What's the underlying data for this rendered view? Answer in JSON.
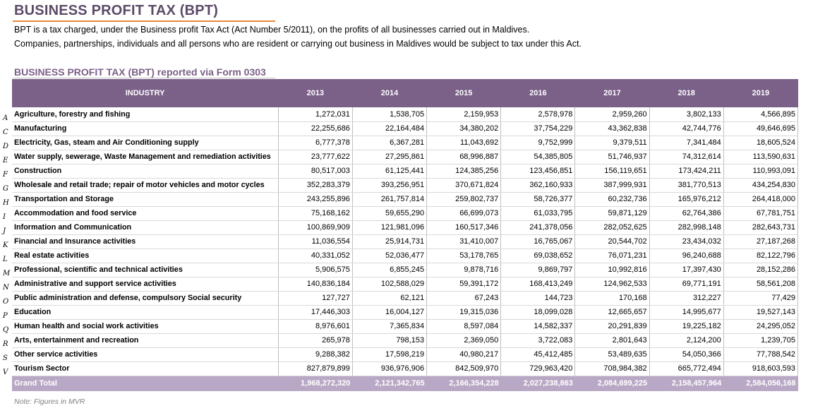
{
  "header": {
    "title": "BUSINESS PROFIT TAX (BPT)",
    "desc_line1": "BPT is a tax charged, under the Business profit Tax Act (Act Number 5/2011), on the profits of all businesses carried out in Maldives.",
    "desc_line2": "Companies, partnerships, individuals and all persons who are resident or carrying out business in Maldives would be subject to tax under this Act."
  },
  "table_title": "BUSINESS PROFIT TAX (BPT) reported via Form 0303",
  "columns": {
    "industry": "INDUSTRY",
    "years": [
      "2013",
      "2014",
      "2015",
      "2016",
      "2017",
      "2018",
      "2019"
    ]
  },
  "rows": [
    {
      "letter": "A",
      "industry": "Agriculture, forestry and fishing",
      "values": [
        "1,272,031",
        "1,538,705",
        "2,159,953",
        "2,578,978",
        "2,959,260",
        "3,802,133",
        "4,566,895"
      ]
    },
    {
      "letter": "C",
      "industry": "Manufacturing",
      "values": [
        "22,255,686",
        "22,164,484",
        "34,380,202",
        "37,754,229",
        "43,362,838",
        "42,744,776",
        "49,646,695"
      ]
    },
    {
      "letter": "D",
      "industry": "Electricity, Gas, steam and Air Conditioning supply",
      "values": [
        "6,777,378",
        "6,367,281",
        "11,043,692",
        "9,752,999",
        "9,379,511",
        "7,341,484",
        "18,605,524"
      ]
    },
    {
      "letter": "E",
      "industry": "Water supply, sewerage, Waste Management and remediation activities",
      "values": [
        "23,777,622",
        "27,295,861",
        "68,996,887",
        "54,385,805",
        "51,746,937",
        "74,312,614",
        "113,590,631"
      ]
    },
    {
      "letter": "F",
      "industry": "Construction",
      "values": [
        "80,517,003",
        "61,125,441",
        "124,385,256",
        "123,456,851",
        "156,119,651",
        "173,424,211",
        "110,993,091"
      ]
    },
    {
      "letter": "G",
      "industry": "Wholesale and retail trade; repair of motor vehicles and motor cycles",
      "values": [
        "352,283,379",
        "393,256,951",
        "370,671,824",
        "362,160,933",
        "387,999,931",
        "381,770,513",
        "434,254,830"
      ]
    },
    {
      "letter": "H",
      "industry": "Transportation and Storage",
      "values": [
        "243,255,896",
        "261,757,814",
        "259,802,737",
        "58,726,377",
        "60,232,736",
        "165,976,212",
        "264,418,000"
      ]
    },
    {
      "letter": "I",
      "industry": "Accommodation and food service",
      "values": [
        "75,168,162",
        "59,655,290",
        "66,699,073",
        "61,033,795",
        "59,871,129",
        "62,764,386",
        "67,781,751"
      ]
    },
    {
      "letter": "J",
      "industry": "Information and Communication",
      "values": [
        "100,869,909",
        "121,981,096",
        "160,517,346",
        "241,378,056",
        "282,052,625",
        "282,998,148",
        "282,643,731"
      ]
    },
    {
      "letter": "K",
      "industry": "Financial and Insurance activities",
      "values": [
        "11,036,554",
        "25,914,731",
        "31,410,007",
        "16,765,067",
        "20,544,702",
        "23,434,032",
        "27,187,268"
      ]
    },
    {
      "letter": "L",
      "industry": "Real estate activities",
      "values": [
        "40,331,052",
        "52,036,477",
        "53,178,765",
        "69,038,652",
        "76,071,231",
        "96,240,688",
        "82,122,796"
      ]
    },
    {
      "letter": "M",
      "industry": "Professional, scientific and technical activities",
      "values": [
        "5,906,575",
        "6,855,245",
        "9,878,716",
        "9,869,797",
        "10,992,816",
        "17,397,430",
        "28,152,286"
      ]
    },
    {
      "letter": "N",
      "industry": "Administrative and support service activities",
      "values": [
        "140,836,184",
        "102,588,029",
        "59,391,172",
        "168,413,249",
        "124,962,533",
        "69,771,191",
        "58,561,208"
      ]
    },
    {
      "letter": "O",
      "industry": "Public administration and defense, compulsory Social security",
      "values": [
        "127,727",
        "62,121",
        "67,243",
        "144,723",
        "170,168",
        "312,227",
        "77,429"
      ]
    },
    {
      "letter": "P",
      "industry": "Education",
      "values": [
        "17,446,303",
        "16,004,127",
        "19,315,036",
        "18,099,028",
        "12,665,657",
        "14,995,677",
        "19,527,143"
      ]
    },
    {
      "letter": "Q",
      "industry": "Human health and social work activities",
      "values": [
        "8,976,601",
        "7,365,834",
        "8,597,084",
        "14,582,337",
        "20,291,839",
        "19,225,182",
        "24,295,052"
      ]
    },
    {
      "letter": "R",
      "industry": "Arts, entertainment and recreation",
      "values": [
        "265,978",
        "798,153",
        "2,369,050",
        "3,722,083",
        "2,801,643",
        "2,124,200",
        "1,239,705"
      ]
    },
    {
      "letter": "S",
      "industry": "Other service activities",
      "values": [
        "9,288,382",
        "17,598,219",
        "40,980,217",
        "45,412,485",
        "53,489,635",
        "54,050,366",
        "77,788,542"
      ]
    },
    {
      "letter": "V",
      "industry": "Tourism Sector",
      "values": [
        "827,879,899",
        "936,976,906",
        "842,509,970",
        "729,963,420",
        "708,984,382",
        "665,772,494",
        "918,603,593"
      ]
    }
  ],
  "grand_total": {
    "label": "Grand Total",
    "values": [
      "1,968,272,320",
      "2,121,342,765",
      "2,166,354,228",
      "2,027,238,863",
      "2,084,699,225",
      "2,158,457,964",
      "2,584,056,168"
    ]
  },
  "note": "Note: Figures in MVR",
  "colors": {
    "header_bg": "#7b6088",
    "total_bg": "#b9a8c5",
    "title": "#5b4a68",
    "accent_line": "#e8893a"
  }
}
